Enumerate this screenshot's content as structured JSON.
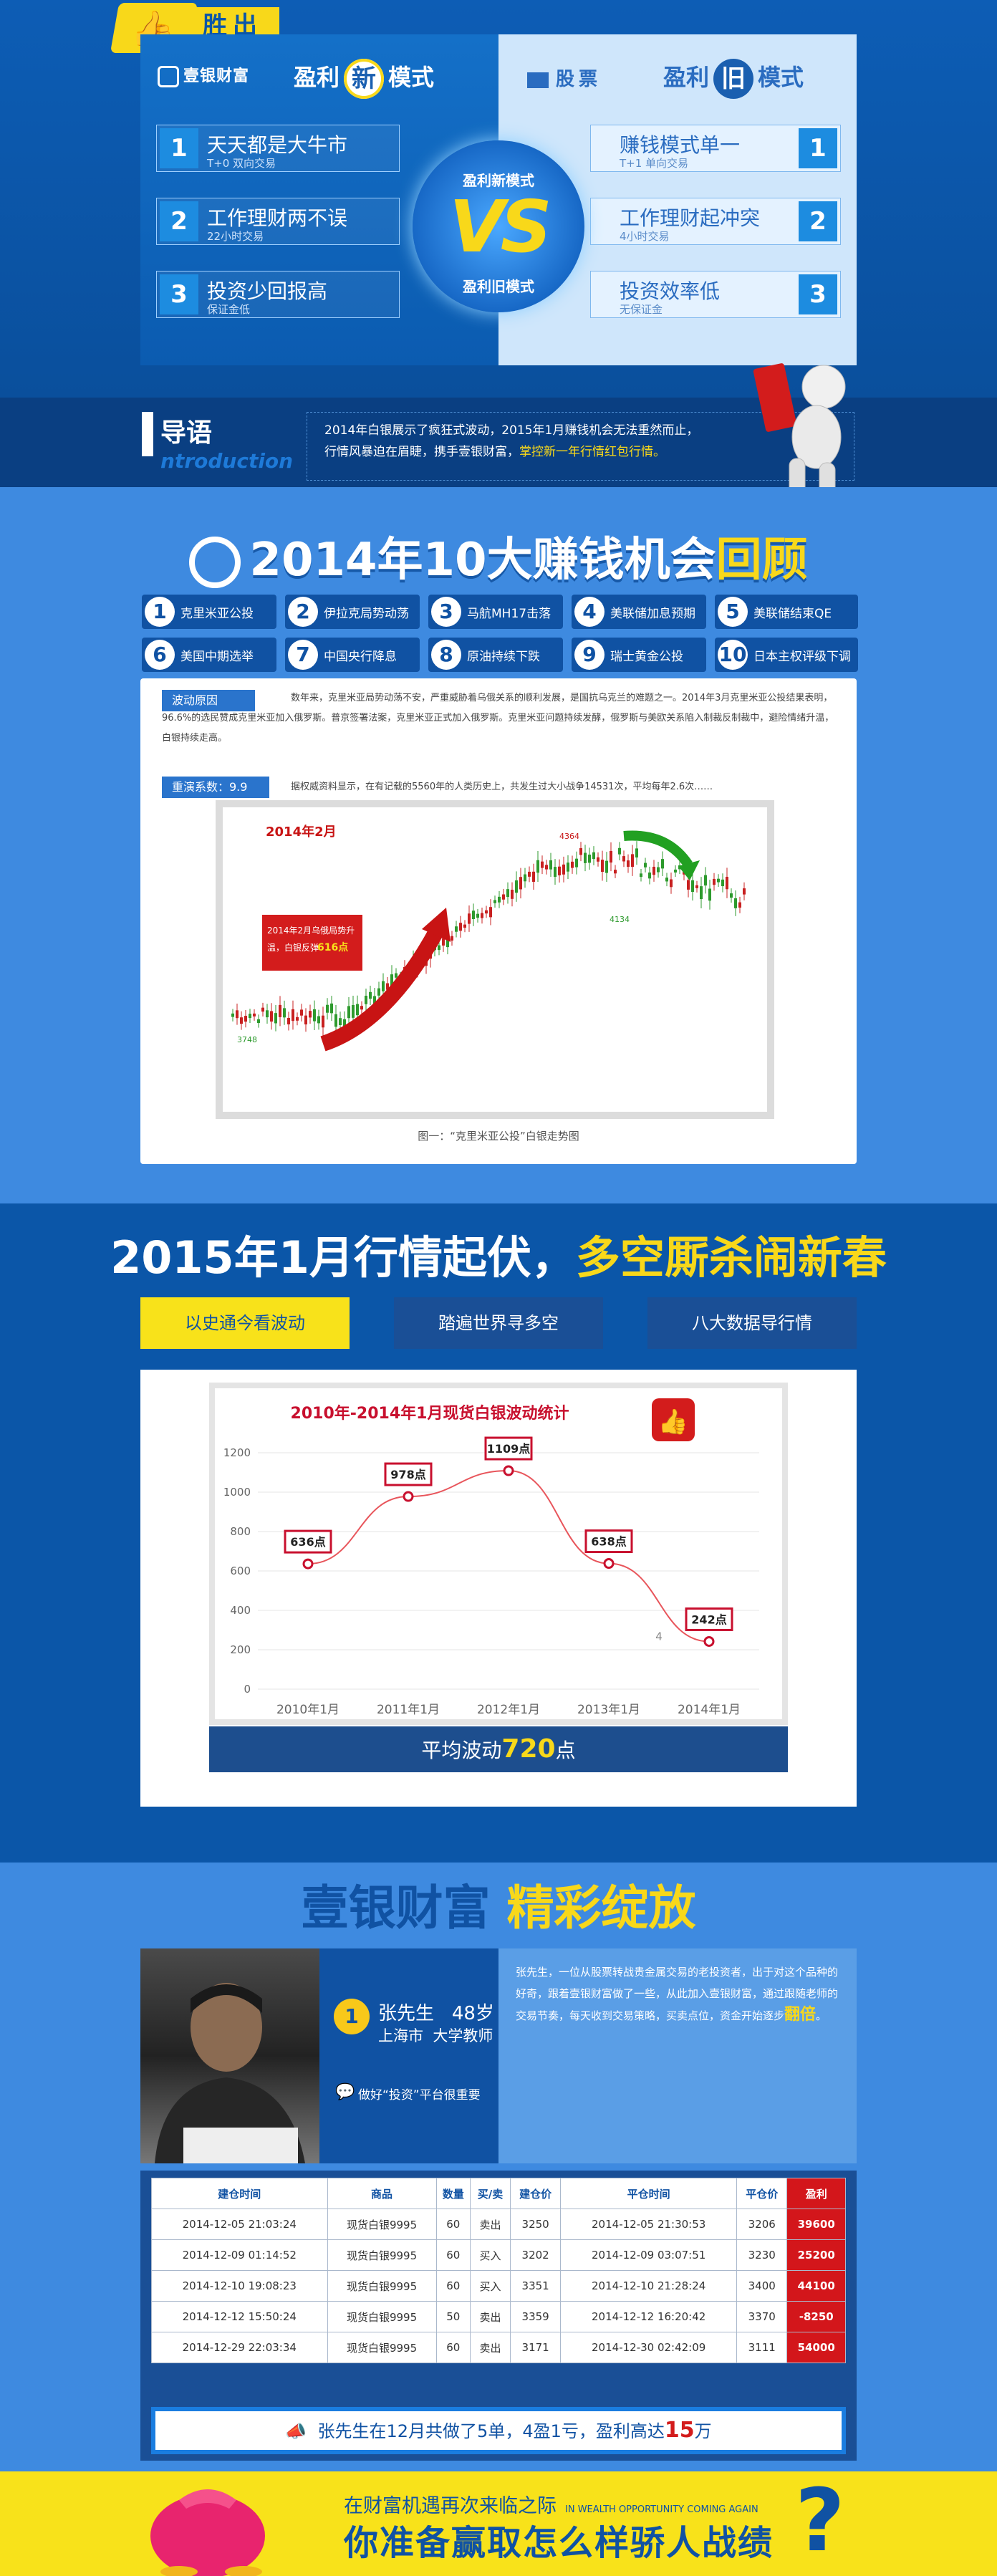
{
  "compare": {
    "badge": "胜出",
    "left_logo": "壹银财富",
    "left_title_a": "盈利",
    "left_title_char": "新",
    "left_title_b": "模式",
    "right_logo": "股票",
    "right_title_a": "盈利",
    "right_title_char": "旧",
    "right_title_b": "模式",
    "vs_text": "VS",
    "vs_new": "盈利新模式",
    "vs_old": "盈利旧模式",
    "left_items": [
      {
        "num": "1",
        "title": "天天都是大牛市",
        "sub": "T+0 双向交易"
      },
      {
        "num": "2",
        "title": "工作理财两不误",
        "sub": "22小时交易"
      },
      {
        "num": "3",
        "title": "投资少回报高",
        "sub": "保证金低"
      }
    ],
    "right_items": [
      {
        "num": "1",
        "title": "赚钱模式单一",
        "sub": "T+1 单向交易"
      },
      {
        "num": "2",
        "title": "工作理财起冲突",
        "sub": "4小时交易"
      },
      {
        "num": "3",
        "title": "投资效率低",
        "sub": "无保证金"
      }
    ]
  },
  "intro": {
    "title": "导语",
    "eng": "ntroduction",
    "line1": "2014年白银展示了疯狂式波动，2015年1月赚钱机会无法重然而止，",
    "line2a": "行情风暴迫在眉睫，携手壹银财富，",
    "line2b": "掌控新一年行情红包行情。",
    "year_hl": "2014"
  },
  "review": {
    "title_a": "2014年10大赚钱机会",
    "title_b": "回顾",
    "events": [
      {
        "n": "1",
        "label": "克里米亚公投"
      },
      {
        "n": "2",
        "label": "伊拉克局势动荡"
      },
      {
        "n": "3",
        "label": "马航MH17击落"
      },
      {
        "n": "4",
        "label": "美联储加息预期"
      },
      {
        "n": "5",
        "label": "美联储结束QE"
      },
      {
        "n": "6",
        "label": "美国中期选举"
      },
      {
        "n": "7",
        "label": "中国央行降息"
      },
      {
        "n": "8",
        "label": "原油持续下跌"
      },
      {
        "n": "9",
        "label": "瑞士黄金公投"
      },
      {
        "n": "10",
        "label": "日本主权评级下调"
      }
    ],
    "tag1": "波动原因",
    "reason_text": "数年来，克里米亚局势动荡不安，严重威胁着乌俄关系的顺利发展，是国抗乌克兰的难题之一。2014年3月克里米亚公投结果表明，96.6%的选民赞成克里米亚加入俄罗斯。普京签署法案，克里米亚正式加入俄罗斯。克里米亚问题持续发酵，俄罗斯与美欧关系陷入制裁反制裁中，避险情绪升温，白银持续走高。",
    "tag2": "重演系数：9.9",
    "rerun_text": "据权威资料显示，在有记载的5560年的人类历史上，共发生过大小战争14531次，平均每年2.6次……",
    "chart_title": "2014年2月",
    "callout_a": "2014年2月乌俄局势升温，白银反弹",
    "callout_b": "616点",
    "low_label": "3748",
    "high_label": "4364",
    "last_label": "4134",
    "caption": "图一：“克里米亚公投”白银走势图"
  },
  "trend": {
    "title_a": "2015年1月行情起伏，",
    "title_b": "多空厮杀闹新春",
    "tabs": [
      "以史通今看波动",
      "踏遍世界寻多空",
      "八大数据导行情"
    ],
    "avg_a": "平均波动",
    "avg_b": "720",
    "avg_c": "点"
  },
  "chart_data": {
    "type": "line",
    "title": "2010年-2014年1月现货白银波动统计",
    "categories": [
      "2010年1月",
      "2011年1月",
      "2012年1月",
      "2013年1月",
      "2014年1月"
    ],
    "values": [
      636,
      978,
      1109,
      638,
      242
    ],
    "data_labels": [
      "636点",
      "978点",
      "1109点",
      "638点",
      "242点"
    ],
    "ylim": [
      0,
      1200
    ],
    "yticks": [
      0,
      200,
      400,
      600,
      800,
      1000,
      1200
    ],
    "grid": true,
    "annotation": "4",
    "line_color": "#e8555b",
    "marker_color": "#c8102e"
  },
  "showcase": {
    "title_a": "壹银财富",
    "title_b": "精彩绽放",
    "medal": "1",
    "name": "张先生",
    "age": "48岁",
    "city": "上海市",
    "job": "大学教师",
    "quote": "做好“投资”平台很重要",
    "story_a": "张先生，一位从股票转战贵金属交易的老投资者，出于对这个品种的好奇，跟着壹银财富做了一些，从此加入壹银财富，通过跟随老师的交易节奏，每天收到交易策略，买卖点位，资金开始逐步",
    "story_b": "翻倍",
    "story_c": "。",
    "headers": [
      "建仓时间",
      "商品",
      "数量",
      "买/卖",
      "建仓价",
      "平仓时间",
      "平仓价",
      "盈利"
    ],
    "rows": [
      [
        "2014-12-05 21:03:24",
        "现货白银9995",
        "60",
        "卖出",
        "3250",
        "2014-12-05 21:30:53",
        "3206",
        "39600"
      ],
      [
        "2014-12-09 01:14:52",
        "现货白银9995",
        "60",
        "买入",
        "3202",
        "2014-12-09 03:07:51",
        "3230",
        "25200"
      ],
      [
        "2014-12-10 19:08:23",
        "现货白银9995",
        "60",
        "买入",
        "3351",
        "2014-12-10 21:28:24",
        "3400",
        "44100"
      ],
      [
        "2014-12-12 15:50:24",
        "现货白银9995",
        "50",
        "卖出",
        "3359",
        "2014-12-12 16:20:42",
        "3370",
        "-8250"
      ],
      [
        "2014-12-29 22:03:34",
        "现货白银9995",
        "60",
        "卖出",
        "3171",
        "2014-12-30 02:42:09",
        "3111",
        "54000"
      ]
    ],
    "summary_a": "张先生在12月共做了5单，4盈1亏，盈利高达",
    "summary_b": "15",
    "summary_c": "万"
  },
  "footer": {
    "line1": "在财富机遇再次来临之际",
    "line1_en": "IN WEALTH OPPORTUNITY COMING AGAIN",
    "line2": "你准备赢取怎么样骄人战绩",
    "qmark": "?"
  }
}
